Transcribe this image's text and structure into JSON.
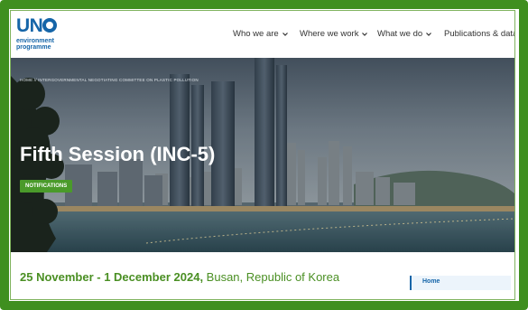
{
  "logo": {
    "brand": "UN",
    "line1": "environment",
    "line2": "programme"
  },
  "nav": {
    "items": [
      {
        "label": "Who we are",
        "has_dropdown": true
      },
      {
        "label": "Where we work",
        "has_dropdown": true
      },
      {
        "label": "What we do",
        "has_dropdown": true
      },
      {
        "label": "Publications & data",
        "has_dropdown": false
      }
    ]
  },
  "hero": {
    "breadcrumb": "HOME  //  INTERGOVERNMENTAL NEGOTIATING COMMITTEE ON PLASTIC POLLUTION",
    "title": "Fifth Session (INC-5)",
    "button_label": "NOTIFICATIONS"
  },
  "session": {
    "dates": "25 November - 1 December 2024,",
    "location": " Busan, Republic of Korea"
  },
  "sidebar": {
    "home_label": "Home"
  },
  "colors": {
    "brand_blue": "#1565a8",
    "accent_green": "#4a9a2a",
    "frame_green": "#3f8f1f"
  }
}
